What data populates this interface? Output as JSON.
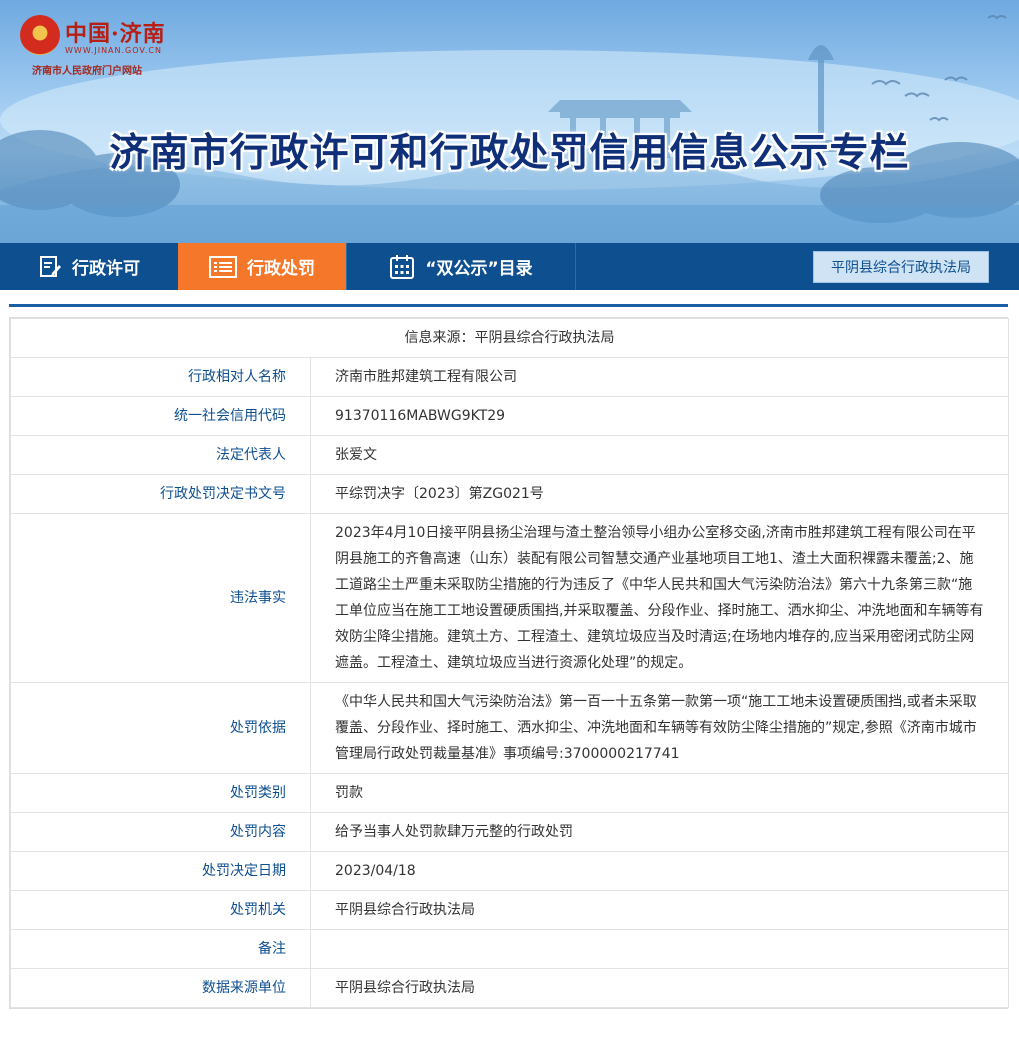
{
  "header": {
    "logo_main": "中国·济南",
    "logo_url": "WWW.JINAN.GOV.CN",
    "logo_sub": "济南市人民政府门户网站",
    "title": "济南市行政许可和行政处罚信用信息公示专栏"
  },
  "nav": {
    "items": [
      {
        "label": "行政许可",
        "icon": "document-edit-icon",
        "active": false
      },
      {
        "label": "行政处罚",
        "icon": "list-icon",
        "active": true
      },
      {
        "label": "“双公示”目录",
        "icon": "calendar-icon",
        "active": false
      }
    ],
    "department": "平阴县综合行政执法局"
  },
  "record": {
    "source": "信息来源：平阴县综合行政执法局",
    "rows": [
      {
        "label": "行政相对人名称",
        "value": "济南市胜邦建筑工程有限公司"
      },
      {
        "label": "统一社会信用代码",
        "value": "91370116MABWG9KT29"
      },
      {
        "label": "法定代表人",
        "value": "张爱文"
      },
      {
        "label": "行政处罚决定书文号",
        "value": "平综罚决字〔2023〕第ZG021号"
      },
      {
        "label": "违法事实",
        "value": "2023年4月10日接平阴县扬尘治理与渣土整治领导小组办公室移交函,济南市胜邦建筑工程有限公司在平阴县施工的齐鲁高速（山东）装配有限公司智慧交通产业基地项目工地1、渣土大面积裸露未覆盖;2、施工道路尘土严重未采取防尘措施的行为违反了《中华人民共和国大气污染防治法》第六十九条第三款“施工单位应当在施工工地设置硬质围挡,并采取覆盖、分段作业、择时施工、洒水抑尘、冲洗地面和车辆等有效防尘降尘措施。建筑土方、工程渣土、建筑垃圾应当及时清运;在场地内堆存的,应当采用密闭式防尘网遮盖。工程渣土、建筑垃圾应当进行资源化处理”的规定。"
      },
      {
        "label": "处罚依据",
        "value": "《中华人民共和国大气污染防治法》第一百一十五条第一款第一项“施工工地未设置硬质围挡,或者未采取覆盖、分段作业、择时施工、洒水抑尘、冲洗地面和车辆等有效防尘降尘措施的”规定,参照《济南市城市管理局行政处罚裁量基准》事项编号:3700000217741"
      },
      {
        "label": "处罚类别",
        "value": "罚款"
      },
      {
        "label": "处罚内容",
        "value": "给予当事人处罚款肆万元整的行政处罚"
      },
      {
        "label": "处罚决定日期",
        "value": "2023/04/18"
      },
      {
        "label": "处罚机关",
        "value": "平阴县综合行政执法局"
      },
      {
        "label": "备注",
        "value": ""
      },
      {
        "label": "数据来源单位",
        "value": "平阴县综合行政执法局"
      }
    ]
  }
}
